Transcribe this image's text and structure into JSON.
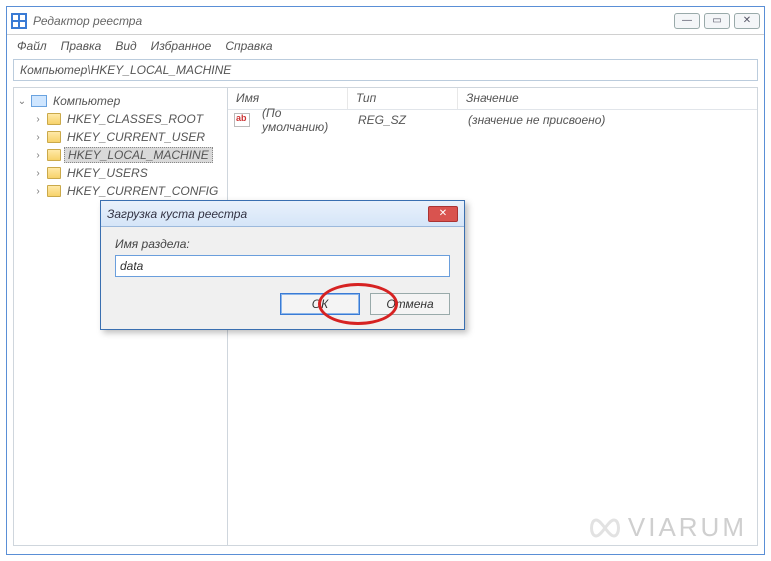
{
  "window": {
    "title": "Редактор реестра"
  },
  "menu": {
    "file": "Файл",
    "edit": "Правка",
    "view": "Вид",
    "fav": "Избранное",
    "help": "Справка"
  },
  "address": "Компьютер\\HKEY_LOCAL_MACHINE",
  "tree": {
    "root": "Компьютер",
    "items": [
      "HKEY_CLASSES_ROOT",
      "HKEY_CURRENT_USER",
      "HKEY_LOCAL_MACHINE",
      "HKEY_USERS",
      "HKEY_CURRENT_CONFIG"
    ],
    "selected_index": 2
  },
  "list": {
    "headers": {
      "name": "Имя",
      "type": "Тип",
      "value": "Значение"
    },
    "rows": [
      {
        "name": "(По умолчанию)",
        "type": "REG_SZ",
        "value": "(значение не присвоено)"
      }
    ]
  },
  "dialog": {
    "title": "Загрузка куста реестра",
    "label": "Имя раздела:",
    "input_value": "data",
    "ok": "ОК",
    "cancel": "Отмена"
  },
  "watermark": "VIARUM"
}
